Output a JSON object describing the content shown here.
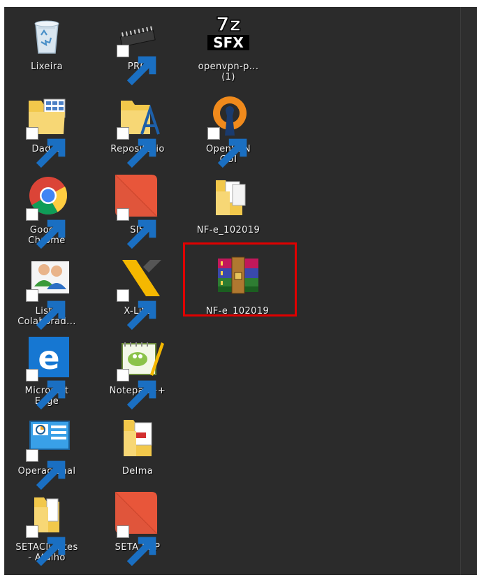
{
  "desktop": {
    "icons": [
      {
        "name": "Lixeira",
        "icon": "recycle-bin-icon"
      },
      {
        "name": "PRG",
        "icon": "chip-icon"
      },
      {
        "name": "openvpn-p...\n(1)",
        "icon": "7z-sfx-icon"
      },
      {
        "name": "Dados",
        "icon": "folder-icon"
      },
      {
        "name": "Repositorio",
        "icon": "folder-icon"
      },
      {
        "name": "OpenVPN\nGUI",
        "icon": "openvpn-icon"
      },
      {
        "name": "Google\nChrome",
        "icon": "chrome-icon"
      },
      {
        "name": "SIS",
        "icon": "app-icon"
      },
      {
        "name": "NF-e_102019",
        "icon": "folder-icon"
      },
      {
        "name": "Lista\nColaborad...",
        "icon": "users-icon"
      },
      {
        "name": "X-Lite",
        "icon": "x-lite-icon"
      },
      {
        "name": "NF-e_102019",
        "icon": "winrar-icon"
      },
      {
        "name": "Microsoft\nEdge",
        "icon": "edge-icon"
      },
      {
        "name": "Notepad++",
        "icon": "notepad-plus-plus-icon"
      },
      {
        "name": "Operacional",
        "icon": "control-panel-icon"
      },
      {
        "name": "Delma",
        "icon": "pdf-folder-icon"
      },
      {
        "name": "SETAClientes\n- Atalho",
        "icon": "folder-icon"
      },
      {
        "name": "SETA ERP",
        "icon": "app-icon"
      }
    ],
    "sfx_logo": {
      "top": "7z",
      "bottom": "SFX"
    },
    "highlight_color": "#e00000",
    "background_color": "#2b2b2b"
  }
}
